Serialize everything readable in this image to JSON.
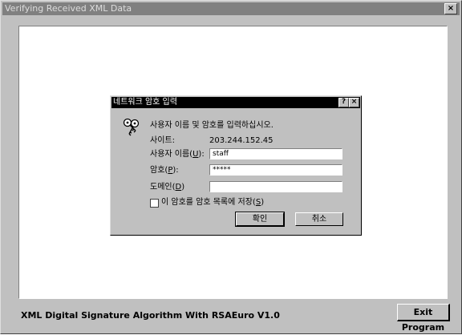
{
  "window": {
    "title": "Verifying Received XML Data",
    "close_glyph": "×"
  },
  "status_text": "XML Digital Signature Algorithm With RSAEuro V1.0",
  "exit_button": "Exit Program",
  "dialog": {
    "title": "네트워크 암호 입력",
    "help_glyph": "?",
    "close_glyph": "×",
    "icon": "key-icon",
    "prompt": "사용자 이름 및 암호를 입력하십시오.",
    "site_label": "사이트:",
    "site_value": "203.244.152.45",
    "username_label_pre": "사용자 이름(",
    "username_label_key": "U",
    "username_label_post": "):",
    "username_value": "staff",
    "password_label_pre": "암호(",
    "password_label_key": "P",
    "password_label_post": "):",
    "password_value": "*****",
    "domain_label_pre": "도메인(",
    "domain_label_key": "D",
    "domain_label_post": ")",
    "domain_value": "",
    "save_label_pre": "이 암호를 암호 목록에 저장(",
    "save_label_key": "S",
    "save_label_post": ")",
    "save_checked": false,
    "ok_button": "확인",
    "cancel_button": "취소"
  }
}
